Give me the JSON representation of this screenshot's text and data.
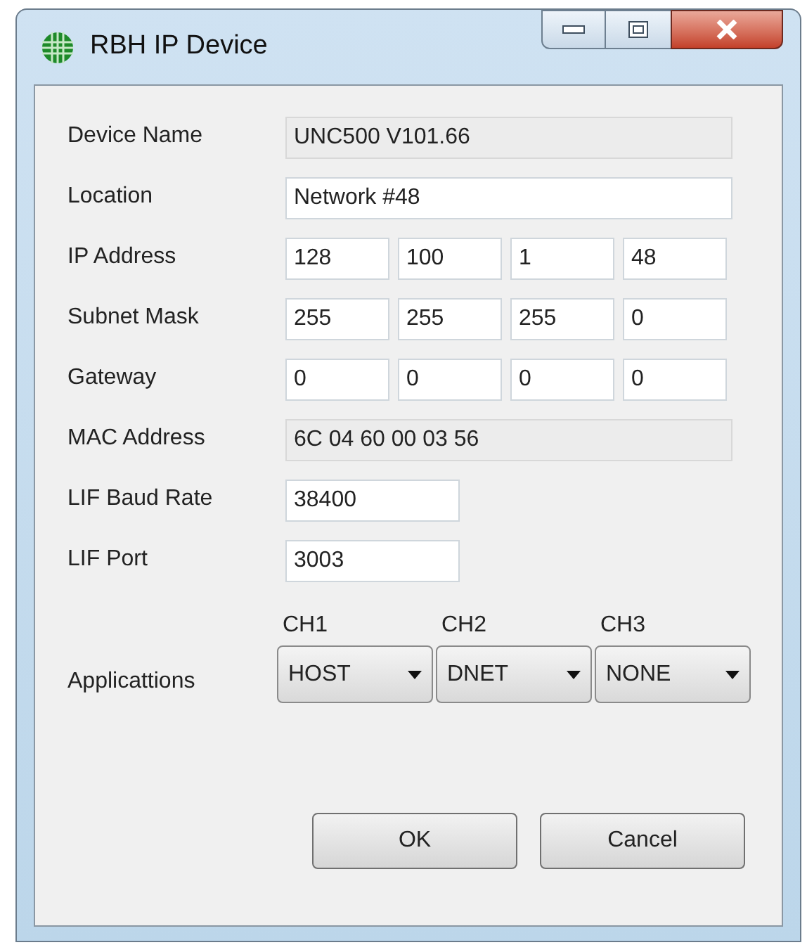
{
  "window": {
    "title": "RBH IP Device"
  },
  "fields": [
    {
      "kind": "text",
      "label": "Device Name",
      "readonly": true,
      "value": "UNC500 V101.66"
    },
    {
      "kind": "text",
      "label": "Location",
      "readonly": false,
      "value": "Network #48"
    },
    {
      "kind": "octets",
      "label": "IP Address",
      "values": [
        "128",
        "100",
        "1",
        "48"
      ]
    },
    {
      "kind": "octets",
      "label": "Subnet Mask",
      "values": [
        "255",
        "255",
        "255",
        "0"
      ]
    },
    {
      "kind": "octets",
      "label": "Gateway",
      "values": [
        "0",
        "0",
        "0",
        "0"
      ]
    },
    {
      "kind": "text",
      "label": "MAC Address",
      "readonly": true,
      "value": "6C 04 60 00 03 56"
    },
    {
      "kind": "short",
      "label": "LIF Baud Rate",
      "readonly": false,
      "value": "38400"
    },
    {
      "kind": "short",
      "label": "LIF Port",
      "readonly": false,
      "value": "3003"
    }
  ],
  "applications": {
    "label": "Applicattions",
    "channels": [
      {
        "name": "CH1",
        "value": "HOST"
      },
      {
        "name": "CH2",
        "value": "DNET"
      },
      {
        "name": "CH3",
        "value": "NONE"
      }
    ]
  },
  "buttons": [
    "OK",
    "Cancel"
  ]
}
